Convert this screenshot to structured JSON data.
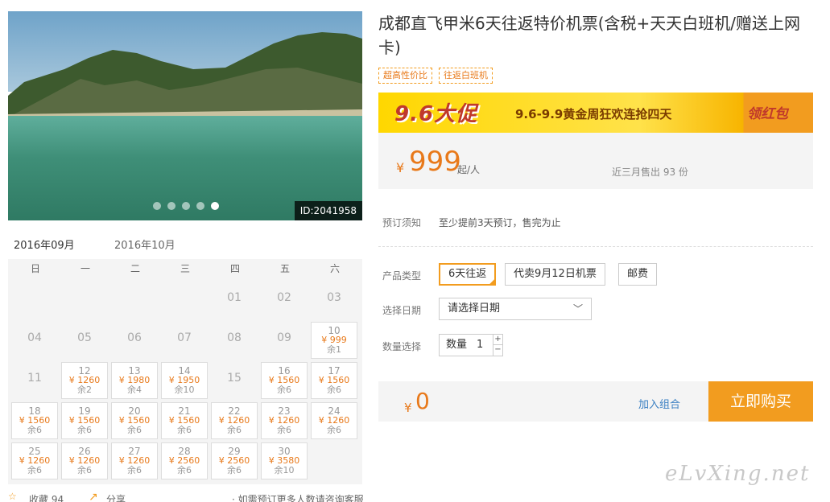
{
  "photo": {
    "id_label": "ID:2041958",
    "slide_count": 5,
    "active_slide": 5
  },
  "calendar": {
    "months": [
      "2016年09月",
      "2016年10月"
    ],
    "active_month": "2016年09月",
    "weekdays": [
      "日",
      "一",
      "二",
      "三",
      "四",
      "五",
      "六"
    ],
    "plain_days": [
      "01",
      "02",
      "03",
      "04",
      "05",
      "06",
      "07",
      "08",
      "09",
      "11",
      "15"
    ],
    "priced_days": [
      {
        "day": "10",
        "price": "¥ 999",
        "remain": "余1"
      },
      {
        "day": "12",
        "price": "¥ 1260",
        "remain": "余2"
      },
      {
        "day": "13",
        "price": "¥ 1980",
        "remain": "余4"
      },
      {
        "day": "14",
        "price": "¥ 1950",
        "remain": "余10"
      },
      {
        "day": "16",
        "price": "¥ 1560",
        "remain": "余6"
      },
      {
        "day": "17",
        "price": "¥ 1560",
        "remain": "余6"
      },
      {
        "day": "18",
        "price": "¥ 1560",
        "remain": "余6"
      },
      {
        "day": "19",
        "price": "¥ 1560",
        "remain": "余6"
      },
      {
        "day": "20",
        "price": "¥ 1560",
        "remain": "余6"
      },
      {
        "day": "21",
        "price": "¥ 1560",
        "remain": "余6"
      },
      {
        "day": "22",
        "price": "¥ 1260",
        "remain": "余6"
      },
      {
        "day": "23",
        "price": "¥ 1260",
        "remain": "余6"
      },
      {
        "day": "24",
        "price": "¥ 1260",
        "remain": "余6"
      },
      {
        "day": "25",
        "price": "¥ 1260",
        "remain": "余6"
      },
      {
        "day": "26",
        "price": "¥ 1260",
        "remain": "余6"
      },
      {
        "day": "27",
        "price": "¥ 1260",
        "remain": "余6"
      },
      {
        "day": "28",
        "price": "¥ 2560",
        "remain": "余6"
      },
      {
        "day": "29",
        "price": "¥ 2560",
        "remain": "余6"
      },
      {
        "day": "30",
        "price": "¥ 3580",
        "remain": "余10"
      }
    ]
  },
  "actions": {
    "favorite_label": "收藏 94",
    "share_label": "分享",
    "note": "· 如需预订更多人数请咨询客服"
  },
  "product": {
    "title": "成都直飞甲米6天往返特价机票(含税+天天白班机/赠送上网卡)",
    "tags": [
      "超高性价比",
      "往返白班机"
    ]
  },
  "promo": {
    "badge": "9.6大促",
    "slogan": "9.6-9.9黄金周狂欢连抢四天",
    "cta": "领红包"
  },
  "price": {
    "currency": "¥",
    "amount": "999",
    "unit": "起/人",
    "sold": "近三月售出 93 份"
  },
  "booking": {
    "notice_label": "预订须知",
    "notice_text": "至少提前3天预订，售完为止",
    "type_label": "产品类型",
    "types": [
      "6天往返",
      "代卖9月12日机票",
      "邮费"
    ],
    "selected_type": "6天往返",
    "date_label": "选择日期",
    "date_placeholder": "请选择日期",
    "qty_label": "数量选择",
    "qty_prefix": "数量",
    "qty_value": "1"
  },
  "checkout": {
    "currency": "¥",
    "total": "0",
    "combo_label": "加入组合",
    "buy_label": "立即购买"
  },
  "watermark": "eLvXing.net",
  "colors": {
    "accent": "#f29c1f",
    "price": "#e8791a",
    "link": "#3a7fc2"
  }
}
